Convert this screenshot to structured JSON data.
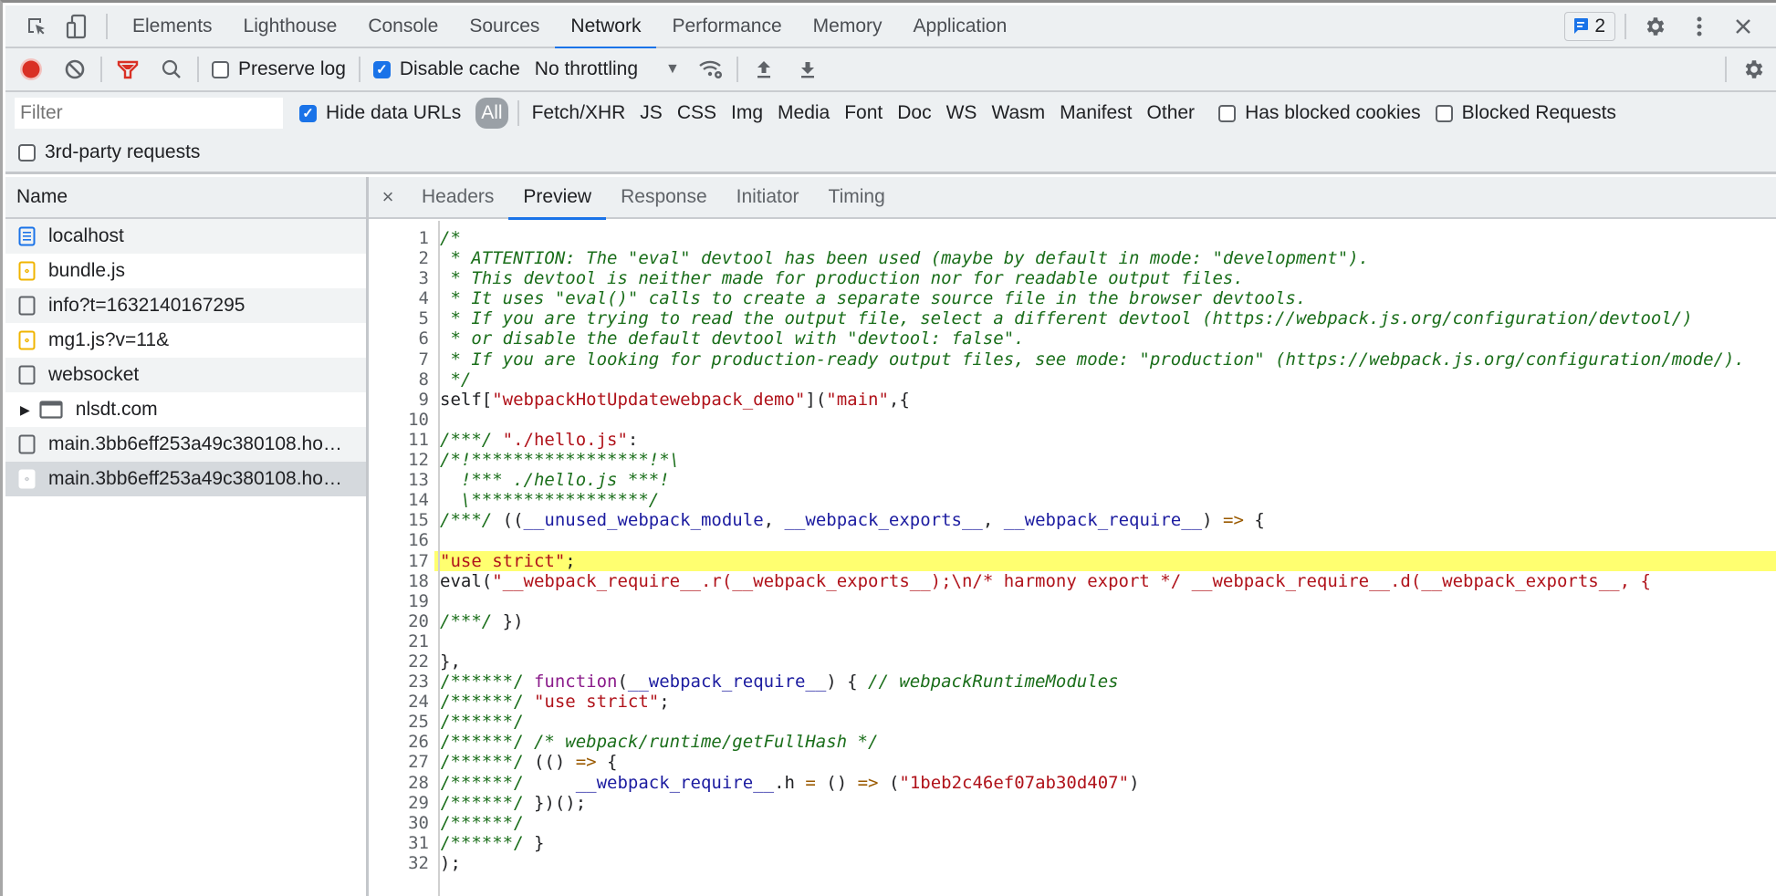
{
  "topbar": {
    "tools": [
      {
        "name": "inspect-element-icon"
      },
      {
        "name": "device-toolbar-icon"
      }
    ],
    "tabs": [
      {
        "label": "Elements",
        "active": false
      },
      {
        "label": "Lighthouse",
        "active": false
      },
      {
        "label": "Console",
        "active": false
      },
      {
        "label": "Sources",
        "active": false
      },
      {
        "label": "Network",
        "active": true
      },
      {
        "label": "Performance",
        "active": false
      },
      {
        "label": "Memory",
        "active": false
      },
      {
        "label": "Application",
        "active": false
      }
    ],
    "issues_count": "2",
    "accent": "#1a73e8"
  },
  "toolbar": {
    "record_color": "#d93025",
    "preserve_log": {
      "label": "Preserve log",
      "checked": false
    },
    "disable_cache": {
      "label": "Disable cache",
      "checked": true
    },
    "throttling": "No throttling"
  },
  "filterbar": {
    "filter_placeholder": "Filter",
    "filter_value": "",
    "hide_data_urls": {
      "label": "Hide data URLs",
      "checked": true
    },
    "types": [
      "All",
      "Fetch/XHR",
      "JS",
      "CSS",
      "Img",
      "Media",
      "Font",
      "Doc",
      "WS",
      "Wasm",
      "Manifest",
      "Other"
    ],
    "active_type": "All",
    "has_blocked_cookies": {
      "label": "Has blocked cookies",
      "checked": false
    },
    "blocked_requests": {
      "label": "Blocked Requests",
      "checked": false
    },
    "third_party": {
      "label": "3rd-party requests",
      "checked": false
    }
  },
  "requests": {
    "header": "Name",
    "items": [
      {
        "name": "localhost",
        "icon": "document-icon"
      },
      {
        "name": "bundle.js",
        "icon": "script-icon"
      },
      {
        "name": "info?t=1632140167295",
        "icon": "generic-file-icon"
      },
      {
        "name": "mg1.js?v=11&",
        "icon": "script-icon"
      },
      {
        "name": "websocket",
        "icon": "generic-file-icon"
      },
      {
        "name": "nlsdt.com",
        "icon": "frame-icon",
        "expandable": true
      },
      {
        "name": "main.3bb6eff253a49c380108.ho…",
        "icon": "generic-file-icon"
      },
      {
        "name": "main.3bb6eff253a49c380108.ho…",
        "icon": "script-icon",
        "selected": true
      }
    ]
  },
  "details": {
    "close_label": "×",
    "tabs": [
      {
        "label": "Headers",
        "active": false
      },
      {
        "label": "Preview",
        "active": true
      },
      {
        "label": "Response",
        "active": false
      },
      {
        "label": "Initiator",
        "active": false
      },
      {
        "label": "Timing",
        "active": false
      }
    ],
    "highlight_line": 17,
    "code_lines": [
      [
        {
          "t": "/*",
          "c": "c"
        }
      ],
      [
        {
          "t": " * ATTENTION: The \"eval\" devtool has been used (maybe by default in mode: \"development\").",
          "c": "c"
        }
      ],
      [
        {
          "t": " * This devtool is neither made for production nor for readable output files.",
          "c": "c"
        }
      ],
      [
        {
          "t": " * It uses \"eval()\" calls to create a separate source file in the browser devtools.",
          "c": "c"
        }
      ],
      [
        {
          "t": " * If you are trying to read the output file, select a different devtool (https://webpack.js.org/configuration/devtool/)",
          "c": "c"
        }
      ],
      [
        {
          "t": " * or disable the default devtool with \"devtool: false\".",
          "c": "c"
        }
      ],
      [
        {
          "t": " * If you are looking for production-ready output files, see mode: \"production\" (https://webpack.js.org/configuration/mode/).",
          "c": "c"
        }
      ],
      [
        {
          "t": " */",
          "c": "c"
        }
      ],
      [
        {
          "t": "self[",
          "c": ""
        },
        {
          "t": "\"webpackHotUpdatewebpack_demo\"",
          "c": "s"
        },
        {
          "t": "](",
          "c": ""
        },
        {
          "t": "\"main\"",
          "c": "s"
        },
        {
          "t": ",{",
          "c": ""
        }
      ],
      [],
      [
        {
          "t": "/***/ ",
          "c": "c"
        },
        {
          "t": "\"./hello.js\"",
          "c": "s"
        },
        {
          "t": ":",
          "c": ""
        }
      ],
      [
        {
          "t": "/*!*****************!*\\",
          "c": "c"
        }
      ],
      [
        {
          "t": "  !*** ./hello.js ***!",
          "c": "c"
        }
      ],
      [
        {
          "t": "  \\*****************/",
          "c": "c"
        }
      ],
      [
        {
          "t": "/***/ ",
          "c": "c"
        },
        {
          "t": "((",
          "c": ""
        },
        {
          "t": "__unused_webpack_module",
          "c": "v"
        },
        {
          "t": ", ",
          "c": ""
        },
        {
          "t": "__webpack_exports__",
          "c": "v"
        },
        {
          "t": ", ",
          "c": ""
        },
        {
          "t": "__webpack_require__",
          "c": "v"
        },
        {
          "t": ") ",
          "c": ""
        },
        {
          "t": "=>",
          "c": "o"
        },
        {
          "t": " {",
          "c": ""
        }
      ],
      [],
      [
        {
          "t": "\"use strict\"",
          "c": "s"
        },
        {
          "t": ";",
          "c": ""
        }
      ],
      [
        {
          "t": "eval(",
          "c": ""
        },
        {
          "t": "\"__webpack_require__.r(__webpack_exports__);\\n/* harmony export */ __webpack_require__.d(__webpack_exports__, {",
          "c": "s"
        }
      ],
      [],
      [
        {
          "t": "/***/ ",
          "c": "c"
        },
        {
          "t": "})",
          "c": ""
        }
      ],
      [],
      [
        {
          "t": "},",
          "c": ""
        }
      ],
      [
        {
          "t": "/******/ ",
          "c": "cn"
        },
        {
          "t": "function",
          "c": "k"
        },
        {
          "t": "(",
          "c": ""
        },
        {
          "t": "__webpack_require__",
          "c": "v"
        },
        {
          "t": ") { ",
          "c": ""
        },
        {
          "t": "// webpackRuntimeModules",
          "c": "c"
        }
      ],
      [
        {
          "t": "/******/ ",
          "c": "cn"
        },
        {
          "t": "\"use strict\"",
          "c": "s"
        },
        {
          "t": ";",
          "c": ""
        }
      ],
      [
        {
          "t": "/******/",
          "c": "cn"
        }
      ],
      [
        {
          "t": "/******/ ",
          "c": "cn"
        },
        {
          "t": "/* webpack/runtime/getFullHash */",
          "c": "c"
        }
      ],
      [
        {
          "t": "/******/ ",
          "c": "cn"
        },
        {
          "t": "(() ",
          "c": ""
        },
        {
          "t": "=>",
          "c": "o"
        },
        {
          "t": " {",
          "c": ""
        }
      ],
      [
        {
          "t": "/******/ ",
          "c": "cn"
        },
        {
          "t": "    ",
          "c": ""
        },
        {
          "t": "__webpack_require__",
          "c": "v"
        },
        {
          "t": ".h ",
          "c": ""
        },
        {
          "t": "=",
          "c": "o"
        },
        {
          "t": " () ",
          "c": ""
        },
        {
          "t": "=>",
          "c": "o"
        },
        {
          "t": " (",
          "c": ""
        },
        {
          "t": "\"1beb2c46ef07ab30d407\"",
          "c": "s"
        },
        {
          "t": ")",
          "c": ""
        }
      ],
      [
        {
          "t": "/******/ ",
          "c": "cn"
        },
        {
          "t": "})();",
          "c": ""
        }
      ],
      [
        {
          "t": "/******/",
          "c": "cn"
        }
      ],
      [
        {
          "t": "/******/ ",
          "c": "cn"
        },
        {
          "t": "}",
          "c": ""
        }
      ],
      [
        {
          "t": ");",
          "c": ""
        }
      ]
    ]
  }
}
